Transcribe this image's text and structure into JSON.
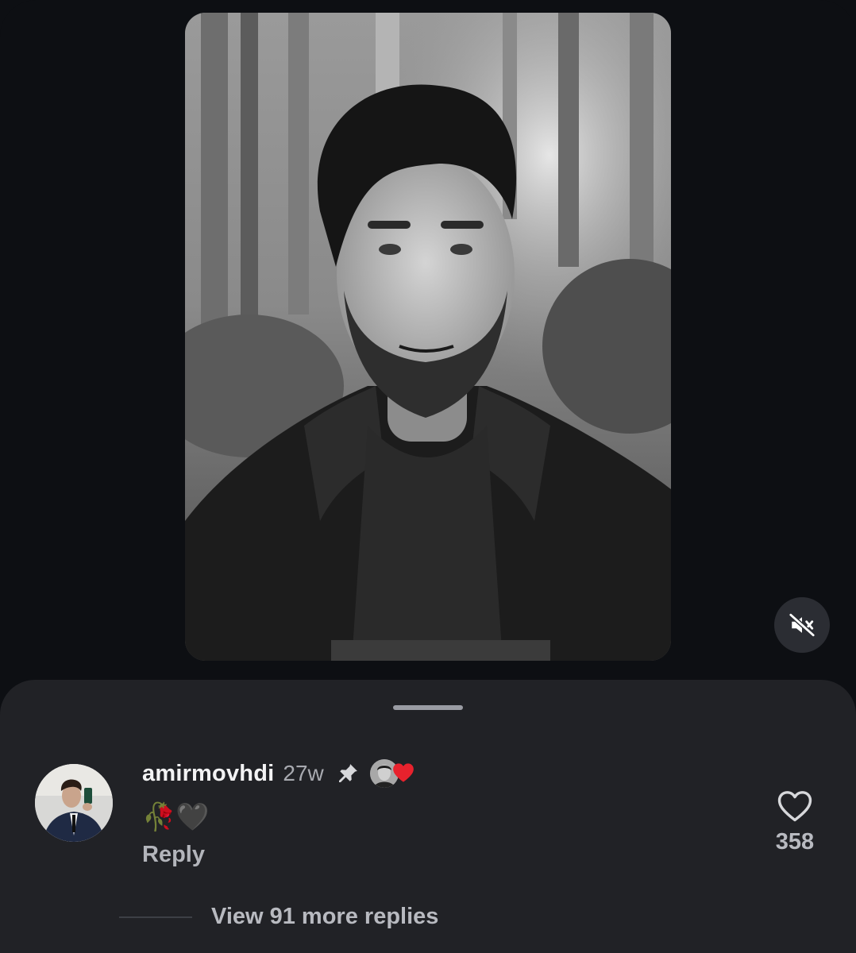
{
  "post": {
    "media_type": "video",
    "media_description_icon": "portrait-photo",
    "muted": true
  },
  "comment": {
    "username": "amirmovhdi",
    "timestamp": "27w",
    "pinned": true,
    "liked_by_creator": true,
    "text": "🥀🖤",
    "reply_label": "Reply",
    "like_count": "358",
    "view_replies_label": "View 91 more replies"
  },
  "colors": {
    "background": "#0d0f13",
    "sheet": "#212226",
    "heart_red": "#e8222d"
  }
}
